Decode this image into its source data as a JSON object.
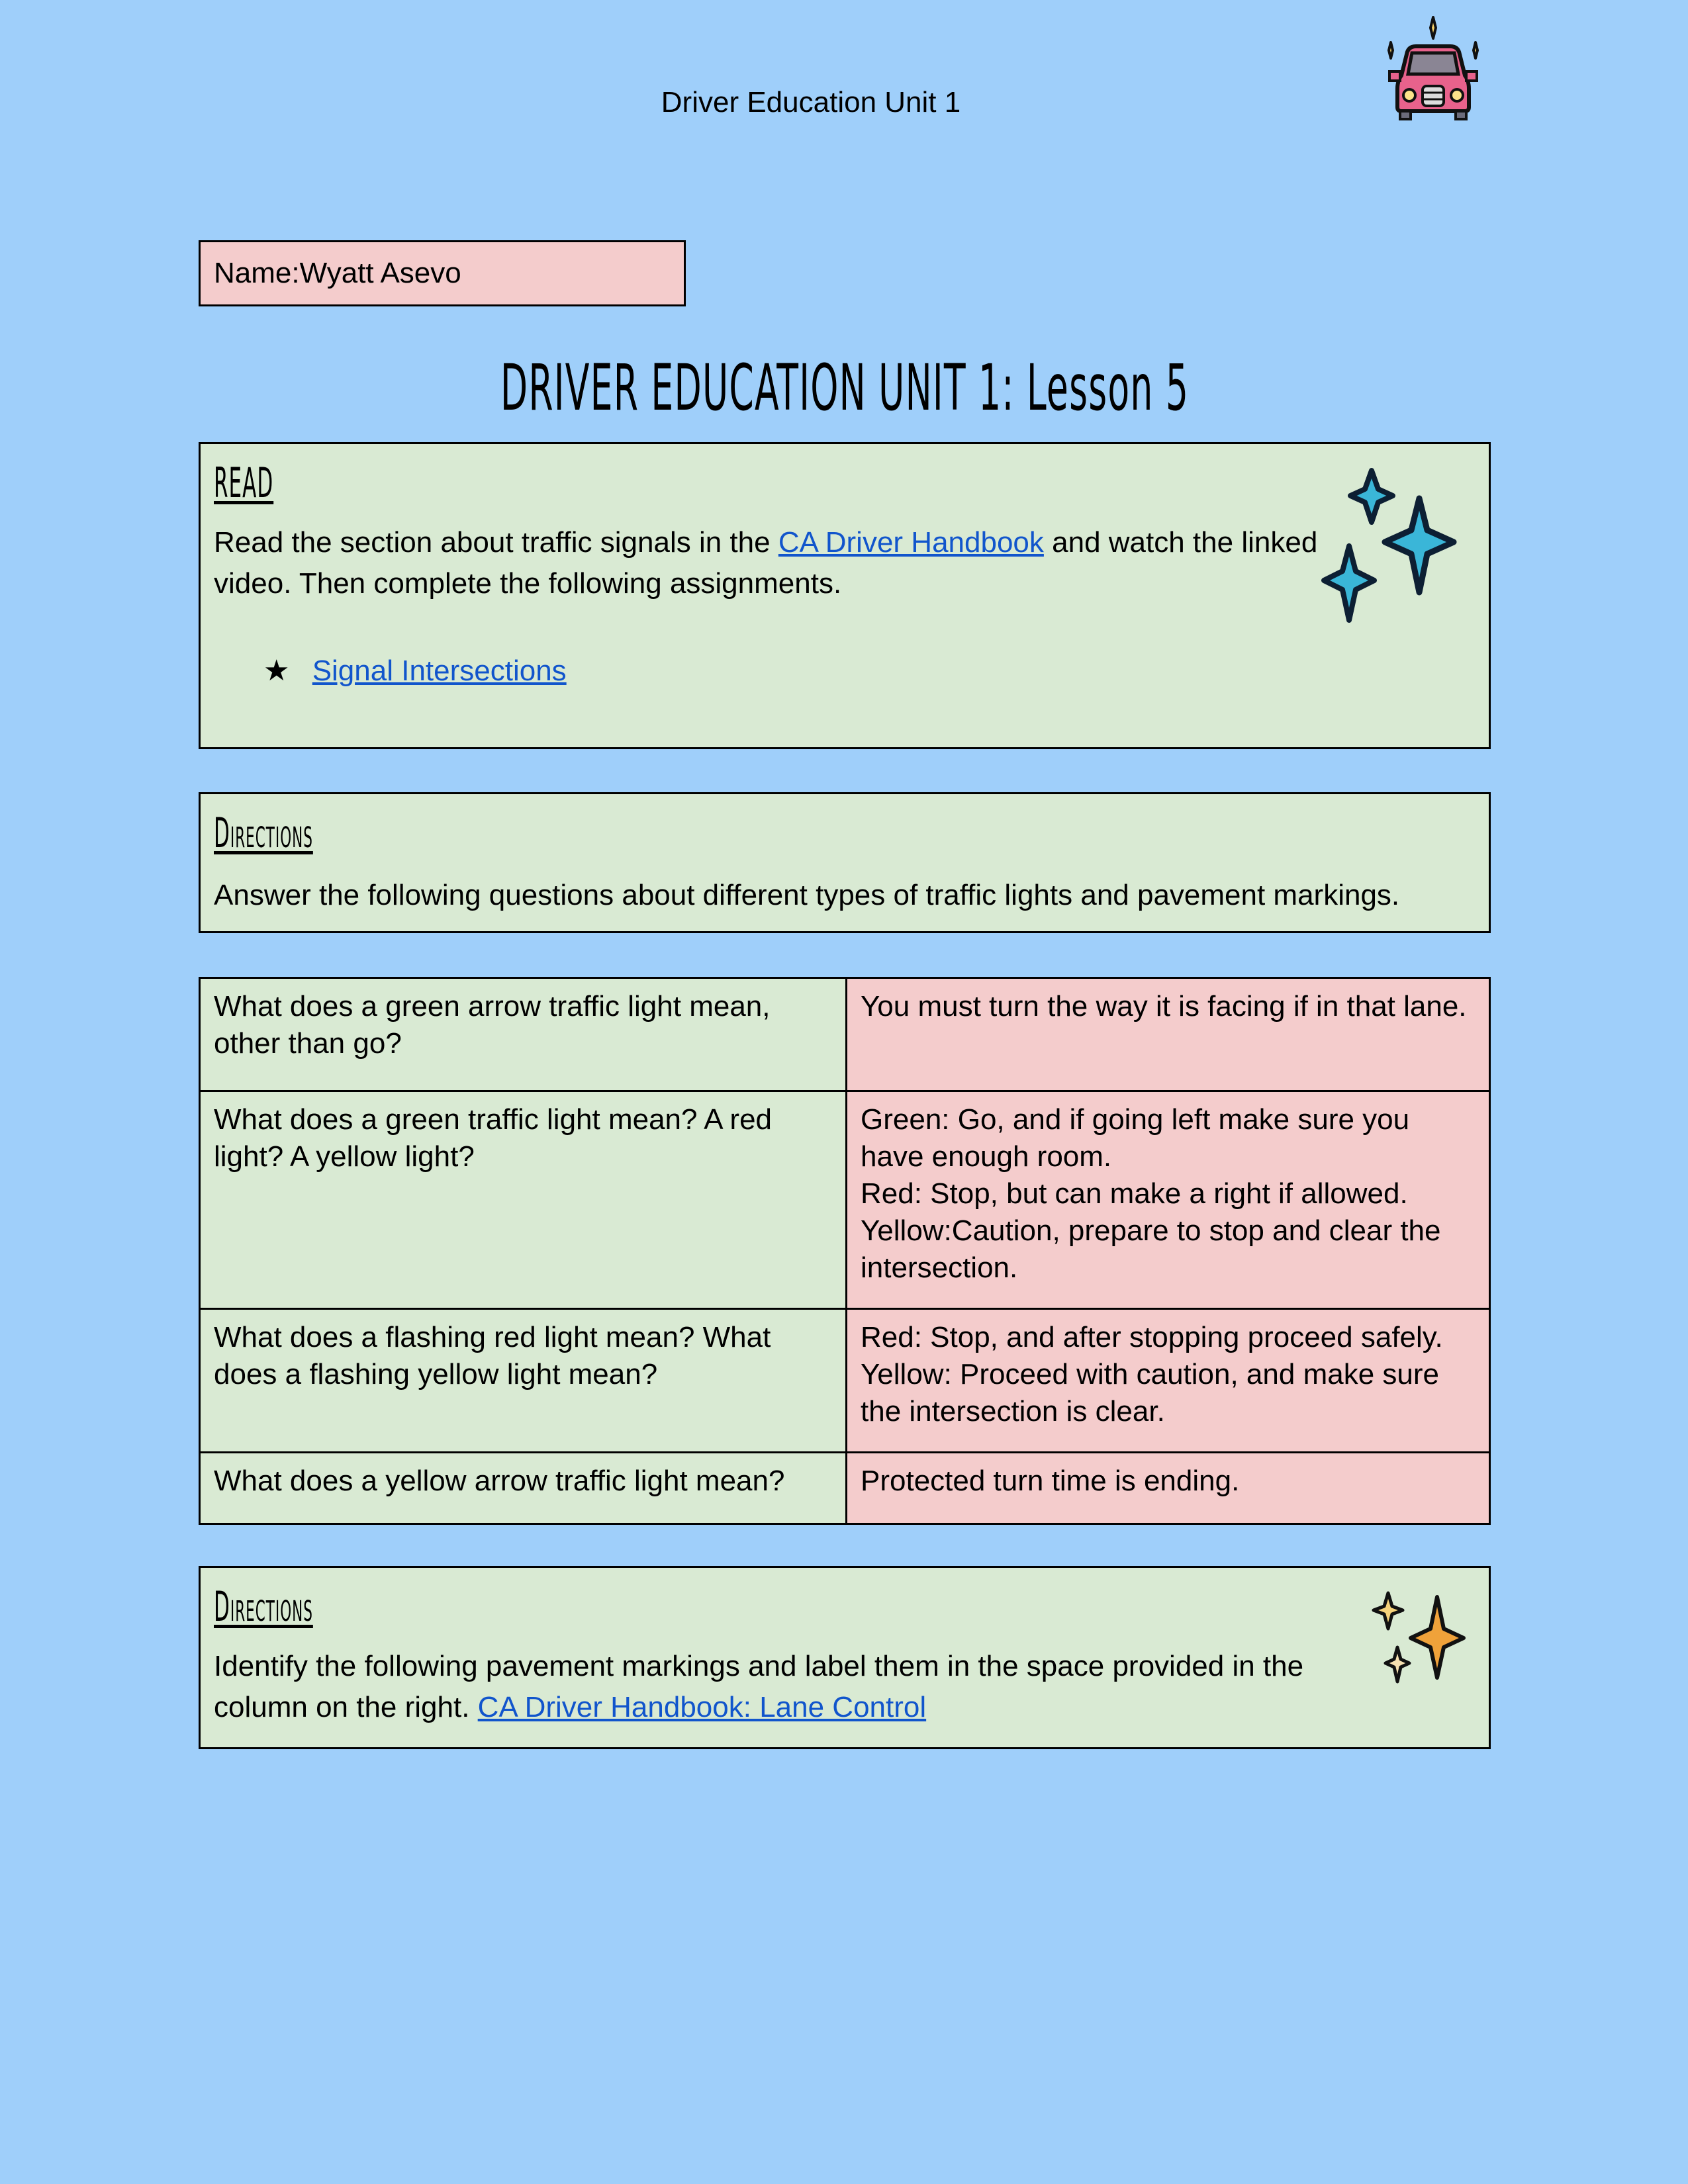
{
  "header": {
    "title": "Driver Education Unit 1",
    "logo_icon": "car-with-sparkles-icon"
  },
  "name_field": {
    "label": "Name:",
    "value": "Wyatt Asevo",
    "full_text": "Name:Wyatt Asevo"
  },
  "lesson_title": "DRIVER EDUCATION UNIT 1: Lesson 5",
  "read_section": {
    "heading": "READ",
    "text_before_link": "Read the section about traffic signals in the ",
    "link_text": "CA Driver Handbook",
    "text_after_link": " and watch the linked video. Then complete the following assignments.",
    "bullet_icon": "★",
    "bullet_link": "Signal Intersections",
    "decor_icon": "blue-sparkles-icon"
  },
  "directions_1": {
    "heading": "Directions",
    "text": "Answer the following questions about different types of traffic lights and pavement markings."
  },
  "qa_table": {
    "rows": [
      {
        "question": "What does a green arrow traffic light mean, other than go?",
        "answer_lines": [
          "You must turn the way it is facing if in that lane."
        ]
      },
      {
        "question": "What does a green traffic light mean? A red light? A yellow light?",
        "answer_lines": [
          "Green: Go, and if going left make sure you have enough room.",
          "Red: Stop, but can make a right if allowed.",
          "Yellow:Caution, prepare to stop and clear the intersection."
        ]
      },
      {
        "question": "What does a flashing red light mean? What does a flashing yellow light mean?",
        "answer_lines": [
          "Red: Stop, and after stopping proceed safely.",
          "Yellow: Proceed with caution, and make sure the intersection is clear."
        ]
      },
      {
        "question": "What does a yellow arrow traffic light mean?",
        "answer_lines": [
          "Protected turn time is ending."
        ]
      }
    ]
  },
  "directions_2": {
    "heading": "Directions",
    "text_before_link": "Identify the following pavement markings and label them in the space provided in the column on the right. ",
    "link_text": "CA Driver Handbook: Lane Control",
    "decor_icon": "orange-sparkles-icon"
  },
  "colors": {
    "page_background": "#9fcffa",
    "green_box": "#d9ead3",
    "pink_box": "#f4cccc",
    "link": "#1155cc"
  }
}
